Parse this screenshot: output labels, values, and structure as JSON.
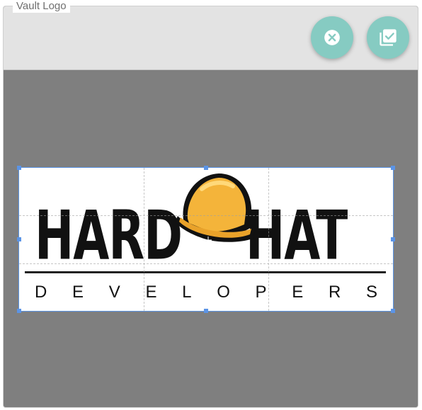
{
  "panel": {
    "legend": "Vault Logo"
  },
  "actions": {
    "cancel_icon": "cancel-circle-icon",
    "confirm_icon": "library-add-check-icon"
  },
  "logo": {
    "word_left": "HARD",
    "word_right": "HAT",
    "subtitle": [
      "D",
      "E",
      "V",
      "E",
      "L",
      "O",
      "P",
      "E",
      "R",
      "S"
    ],
    "helmet_color": "#f4b43a"
  }
}
